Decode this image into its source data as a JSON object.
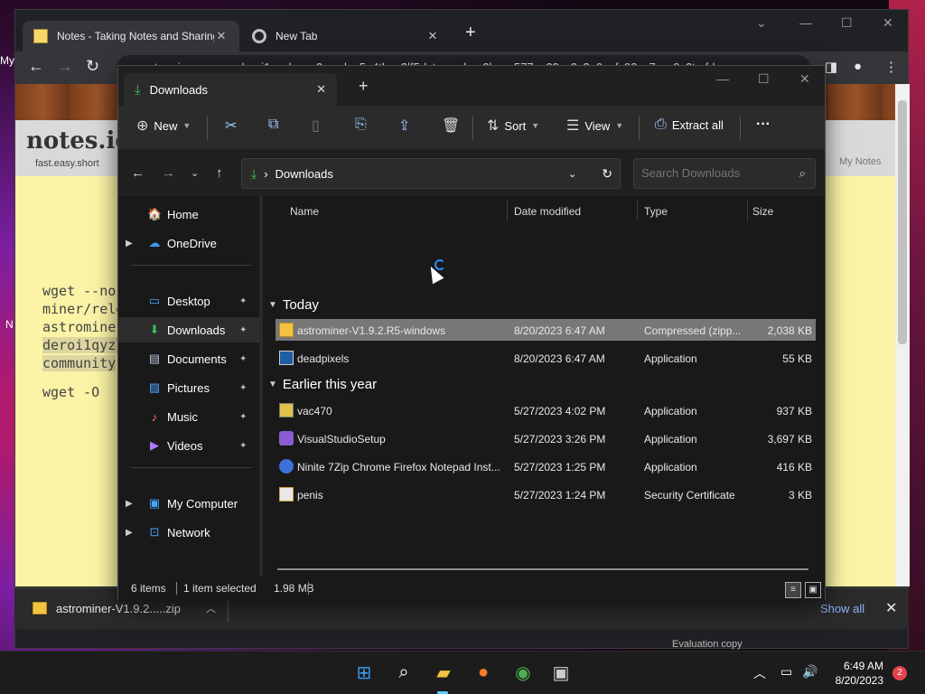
{
  "browser": {
    "tabs": [
      {
        "title": "Notes - Taking Notes and Sharing"
      },
      {
        "title": "New Tab"
      }
    ],
    "omnibox": "astrominer.exe -w deroi1qyzlxxgq2weqlyq5u4tkng2lf5dxtwanqhse2hwm577ps22zv2x2q9pvfz92xz7xxv9z2tmfdegg",
    "left_glyph": "My",
    "side_glyph": "N"
  },
  "notes_page": {
    "logo": "notes.io",
    "tagline": "fast.easy.short",
    "mynotes": "My Notes",
    "lines": [
      "wget --no",
      "miner/rele",
      "astrominer",
      "deroi1qyzl",
      "community",
      "wget -O"
    ]
  },
  "download_shelf": {
    "item": "astrominer-V1.9.2.....zip",
    "show_all": "Show all"
  },
  "explorer": {
    "tab_title": "Downloads",
    "toolbar": {
      "new": "New",
      "sort": "Sort",
      "view": "View",
      "extract": "Extract all",
      "more": "···"
    },
    "address": {
      "path": "Downloads",
      "sep": "›"
    },
    "search_placeholder": "Search Downloads",
    "nav": [
      {
        "label": "Home",
        "icon": "🏠"
      },
      {
        "label": "OneDrive",
        "icon": "☁"
      },
      {
        "label": "Desktop",
        "icon": "▭"
      },
      {
        "label": "Downloads",
        "icon": "⬇"
      },
      {
        "label": "Documents",
        "icon": "▤"
      },
      {
        "label": "Pictures",
        "icon": "▨"
      },
      {
        "label": "Music",
        "icon": "♪"
      },
      {
        "label": "Videos",
        "icon": "▶"
      },
      {
        "label": "My Computer",
        "icon": "▣"
      },
      {
        "label": "Network",
        "icon": "⊡"
      }
    ],
    "columns": {
      "name": "Name",
      "date": "Date modified",
      "type": "Type",
      "size": "Size"
    },
    "groups": [
      {
        "label": "Today",
        "files": [
          {
            "name": "astrominer-V1.9.2.R5-windows",
            "date": "8/20/2023 6:47 AM",
            "type": "Compressed (zipp...",
            "size": "2,038 KB",
            "icon": "zip"
          },
          {
            "name": "deadpixels",
            "date": "8/20/2023 6:47 AM",
            "type": "Application",
            "size": "55 KB",
            "icon": "app"
          }
        ]
      },
      {
        "label": "Earlier this year",
        "files": [
          {
            "name": "vac470",
            "date": "5/27/2023 4:02 PM",
            "type": "Application",
            "size": "937 KB",
            "icon": "app"
          },
          {
            "name": "VisualStudioSetup",
            "date": "5/27/2023 3:26 PM",
            "type": "Application",
            "size": "3,697 KB",
            "icon": "vs"
          },
          {
            "name": "Ninite 7Zip Chrome Firefox Notepad Inst...",
            "date": "5/27/2023 1:25 PM",
            "type": "Application",
            "size": "416 KB",
            "icon": "ninite"
          },
          {
            "name": "penis",
            "date": "5/27/2023 1:24 PM",
            "type": "Security Certificate",
            "size": "3 KB",
            "icon": "cert"
          }
        ]
      }
    ],
    "status": {
      "count": "6 items",
      "selected": "1 item selected",
      "size": "1.98 MB"
    }
  },
  "taskbar": {
    "time": "6:49 AM",
    "date": "8/20/2023",
    "badge": "2",
    "watermark": "Evaluation copy"
  },
  "colors": {
    "accent": "#60cdff",
    "folder": "#f3c242",
    "download_green": "#3fbf5b"
  }
}
